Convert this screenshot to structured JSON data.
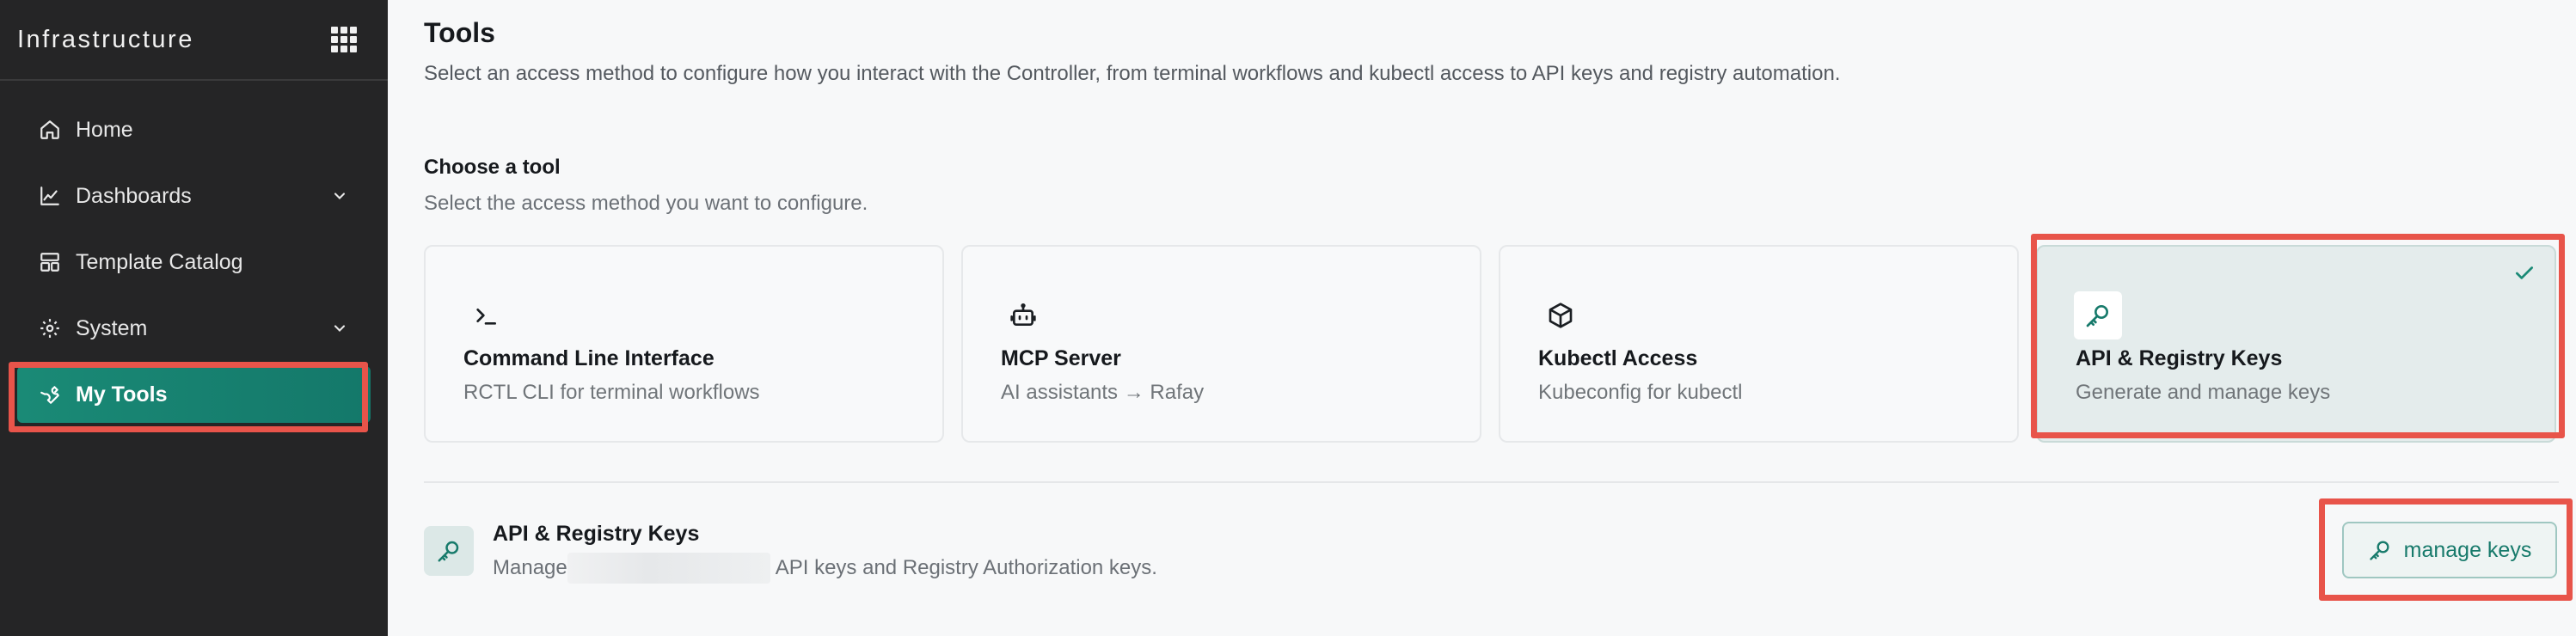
{
  "sidebar": {
    "brand": "Infrastructure",
    "items": [
      {
        "label": "Home",
        "icon": "home-icon"
      },
      {
        "label": "Dashboards",
        "icon": "chart-line-icon",
        "has_chevron": true
      },
      {
        "label": "Template Catalog",
        "icon": "layout-icon"
      },
      {
        "label": "System",
        "icon": "gear-icon",
        "has_chevron": true
      },
      {
        "label": "My Tools",
        "icon": "wrench-icon",
        "active": true
      }
    ]
  },
  "header": {
    "title": "Tools",
    "description": "Select an access method to configure how you interact with the Controller, from terminal workflows and kubectl access to API keys and registry automation."
  },
  "chooser": {
    "title": "Choose a tool",
    "description": "Select the access method you want to configure.",
    "cards": [
      {
        "title": "Command Line Interface",
        "subtitle": "RCTL CLI for terminal workflows",
        "icon": "terminal-icon"
      },
      {
        "title": "MCP Server",
        "subtitle": "AI assistants → Rafay",
        "icon": "robot-icon"
      },
      {
        "title": "Kubectl Access",
        "subtitle": "Kubeconfig for kubectl",
        "icon": "cube-icon"
      },
      {
        "title": "API & Registry Keys",
        "subtitle": "Generate and manage keys",
        "icon": "key-icon",
        "selected": true
      }
    ]
  },
  "detail": {
    "title": "API & Registry Keys",
    "desc_prefix": "Manage",
    "desc_suffix": "API keys and Registry Authorization keys.",
    "button_label": "manage keys"
  },
  "colors": {
    "accent": "#177a6b",
    "sidebar_bg": "#252526",
    "active_nav": "#1a8a76",
    "highlight": "#e8544a"
  }
}
